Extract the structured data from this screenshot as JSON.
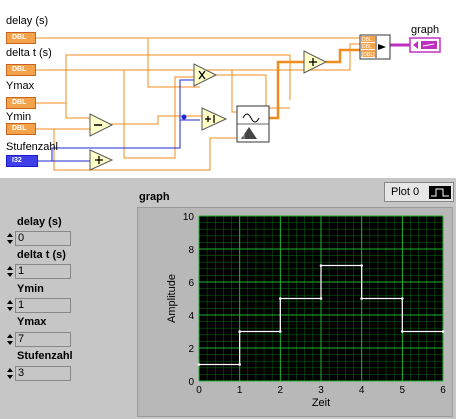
{
  "block_diagram": {
    "controls": [
      {
        "name": "delay (s)",
        "type": "DBL"
      },
      {
        "name": "delta t (s)",
        "type": "DBL"
      },
      {
        "name": "Ymax",
        "type": "DBL"
      },
      {
        "name": "Ymin",
        "type": "DBL"
      },
      {
        "name": "Stufenzahl",
        "type": "I32"
      }
    ],
    "graph_indicator_label": "graph",
    "colors": {
      "dbl_wire": "#f08c1e",
      "i32_wire": "#1e28d2",
      "cluster_wire": "#c030c0",
      "node_fill": "#ffffc8"
    }
  },
  "front_panel": {
    "controls": [
      {
        "label": "delay (s)",
        "value": "0"
      },
      {
        "label": "delta t (s)",
        "value": "1"
      },
      {
        "label": "Ymin",
        "value": "1"
      },
      {
        "label": "Ymax",
        "value": "7"
      },
      {
        "label": "Stufenzahl",
        "value": "3"
      }
    ],
    "graph": {
      "label": "graph",
      "legend_label": "Plot 0"
    }
  },
  "chart_data": {
    "type": "line",
    "xlabel": "Zeit",
    "ylabel": "Amplitude",
    "xlim": [
      0,
      6
    ],
    "ylim": [
      0,
      10
    ],
    "xticks": [
      "0",
      "1",
      "2",
      "3",
      "4",
      "5",
      "6"
    ],
    "yticks": [
      "0",
      "2",
      "4",
      "6",
      "8",
      "10"
    ],
    "grid": true,
    "series": [
      {
        "step": true,
        "color": "#ffffff",
        "x": [
          0,
          1,
          1,
          2,
          2,
          3,
          3,
          4,
          4,
          5,
          5,
          6
        ],
        "y": [
          1,
          1,
          3,
          3,
          5,
          5,
          7,
          7,
          5,
          5,
          3,
          3
        ]
      }
    ]
  }
}
